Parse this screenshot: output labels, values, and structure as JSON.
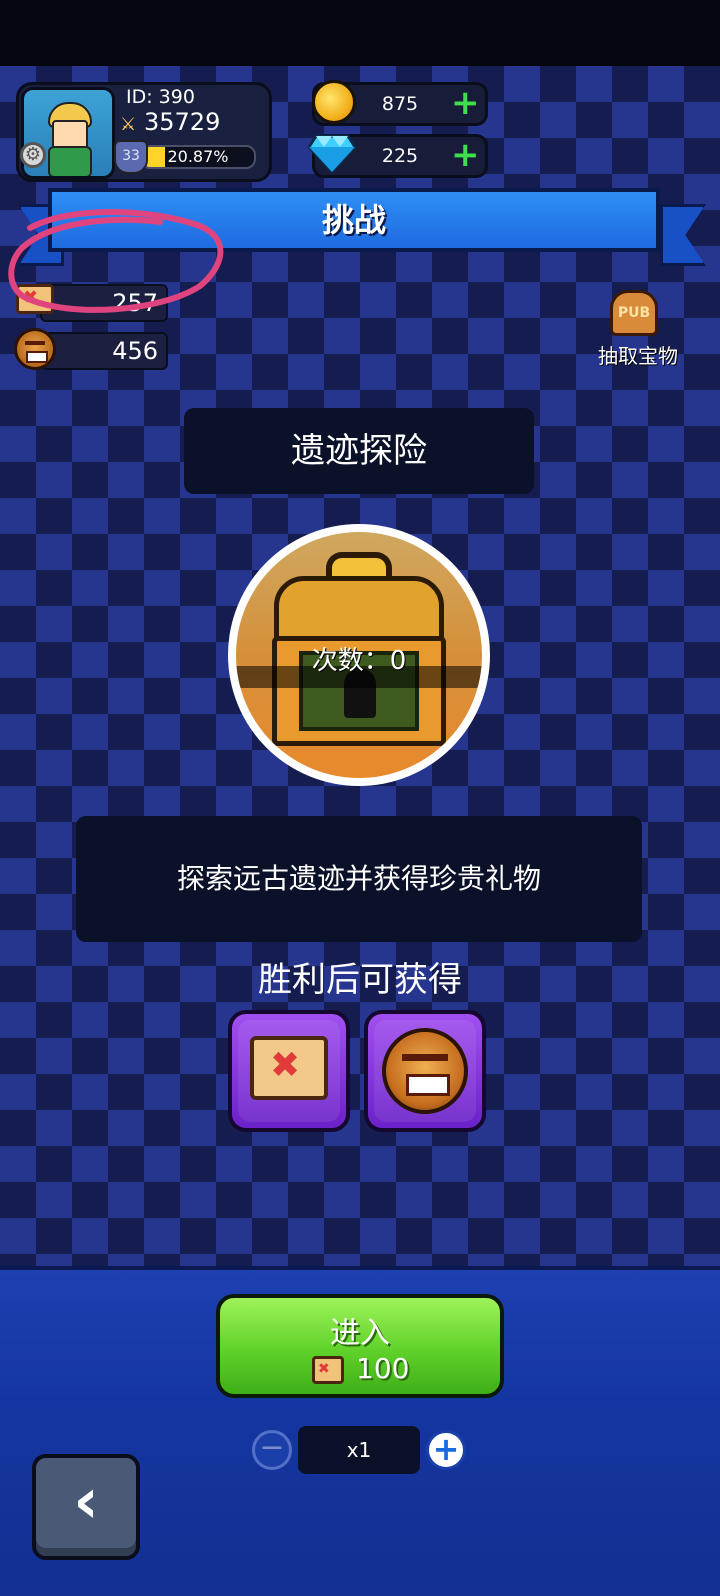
{
  "player": {
    "id_label": "ID: 390",
    "power": "35729",
    "level": "33",
    "xp_percent": "20.87%",
    "xp_fraction": 0.2087
  },
  "currency": {
    "coins": "875",
    "gems": "225"
  },
  "header": {
    "title": "挑战"
  },
  "resources": {
    "maps": "257",
    "masks": "456"
  },
  "pub": {
    "label": "抽取宝物",
    "icon_text": "PUB"
  },
  "event": {
    "title": "遗迹探险",
    "attempts_label": "次数：0",
    "description": "探索远古遗迹并获得珍贵礼物",
    "rewards_label": "胜利后可获得",
    "rewards": [
      "map-icon",
      "mask-icon"
    ]
  },
  "enter": {
    "label": "进入",
    "cost": "100"
  },
  "stepper": {
    "value": "x1"
  },
  "colors": {
    "board_light": "#26368f",
    "board_dark": "#151c4f",
    "banner": "#1f6be0",
    "enter_green": "#5fd12a",
    "reward_purple": "#8a3be0",
    "annotation": "#e0447f"
  }
}
